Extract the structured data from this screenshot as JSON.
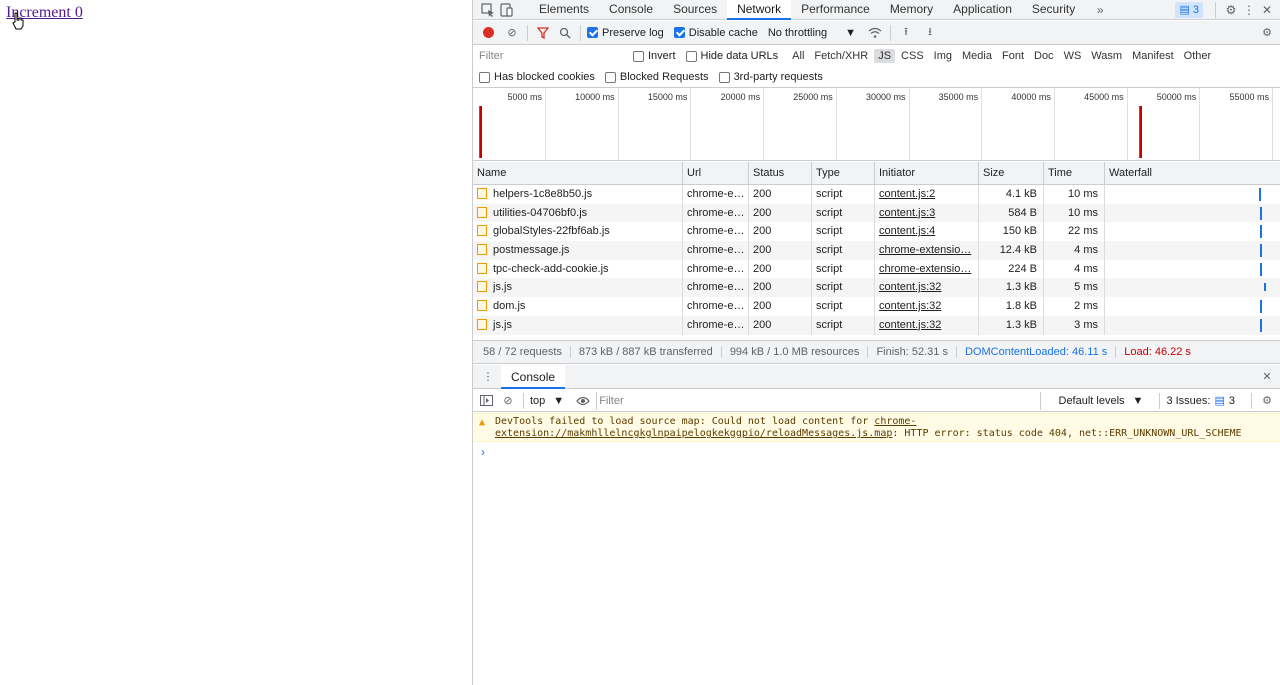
{
  "page": {
    "link_text": "Increment 0"
  },
  "tabs": [
    "Elements",
    "Console",
    "Sources",
    "Network",
    "Performance",
    "Memory",
    "Application",
    "Security"
  ],
  "active_tab": "Network",
  "issues_count": "3",
  "toolbar": {
    "preserve_log": "Preserve log",
    "disable_cache": "Disable cache",
    "throttling": "No throttling"
  },
  "filter": {
    "placeholder": "Filter",
    "invert": "Invert",
    "hide_data_urls": "Hide data URLs",
    "types": [
      "All",
      "Fetch/XHR",
      "JS",
      "CSS",
      "Img",
      "Media",
      "Font",
      "Doc",
      "WS",
      "Wasm",
      "Manifest",
      "Other"
    ],
    "active_type": "JS",
    "has_blocked_cookies": "Has blocked cookies",
    "blocked_requests": "Blocked Requests",
    "third_party": "3rd-party requests"
  },
  "overview_ticks": [
    "5000 ms",
    "10000 ms",
    "15000 ms",
    "20000 ms",
    "25000 ms",
    "30000 ms",
    "35000 ms",
    "40000 ms",
    "45000 ms",
    "50000 ms",
    "55000 ms"
  ],
  "columns": [
    "Name",
    "Url",
    "Status",
    "Type",
    "Initiator",
    "Size",
    "Time",
    "Waterfall"
  ],
  "rows": [
    {
      "name": "helpers-1c8e8b50.js",
      "url": "chrome-e…",
      "status": "200",
      "type": "script",
      "initiator": "content.js:2",
      "size": "4.1 kB",
      "time": "10 ms"
    },
    {
      "name": "utilities-04706bf0.js",
      "url": "chrome-e…",
      "status": "200",
      "type": "script",
      "initiator": "content.js:3",
      "size": "584 B",
      "time": "10 ms"
    },
    {
      "name": "globalStyles-22fbf6ab.js",
      "url": "chrome-e…",
      "status": "200",
      "type": "script",
      "initiator": "content.js:4",
      "size": "150 kB",
      "time": "22 ms"
    },
    {
      "name": "postmessage.js",
      "url": "chrome-e…",
      "status": "200",
      "type": "script",
      "initiator": "chrome-extensio…",
      "size": "12.4 kB",
      "time": "4 ms"
    },
    {
      "name": "tpc-check-add-cookie.js",
      "url": "chrome-e…",
      "status": "200",
      "type": "script",
      "initiator": "chrome-extensio…",
      "size": "224 B",
      "time": "4 ms"
    },
    {
      "name": "js.js",
      "url": "chrome-e…",
      "status": "200",
      "type": "script",
      "initiator": "content.js:32",
      "size": "1.3 kB",
      "time": "5 ms"
    },
    {
      "name": "dom.js",
      "url": "chrome-e…",
      "status": "200",
      "type": "script",
      "initiator": "content.js:32",
      "size": "1.8 kB",
      "time": "2 ms"
    },
    {
      "name": "js.js",
      "url": "chrome-e…",
      "status": "200",
      "type": "script",
      "initiator": "content.js:32",
      "size": "1.3 kB",
      "time": "3 ms"
    }
  ],
  "status": {
    "requests": "58 / 72 requests",
    "transferred": "873 kB / 887 kB transferred",
    "resources": "994 kB / 1.0 MB resources",
    "finish": "Finish: 52.31 s",
    "dom_content_loaded": "DOMContentLoaded: 46.11 s",
    "load": "Load: 46.22 s"
  },
  "drawer": {
    "tab": "Console",
    "context": "top",
    "filter_placeholder": "Filter",
    "levels": "Default levels",
    "issues": "3 Issues:",
    "issues_count": "3"
  },
  "warning": {
    "text1": "DevTools failed to load source map: Could not load content for ",
    "link": "chrome-extension://makmhllelncgkglnpaipelogkekggpio/reloadMessages.js.map",
    "text2": ": HTTP error: status code 404, net::ERR_UNKNOWN_URL_SCHEME"
  },
  "colors": {
    "accent": "#1a73e8",
    "dcl": "#1a73e8",
    "load": "#c80000",
    "record": "#d93025"
  }
}
